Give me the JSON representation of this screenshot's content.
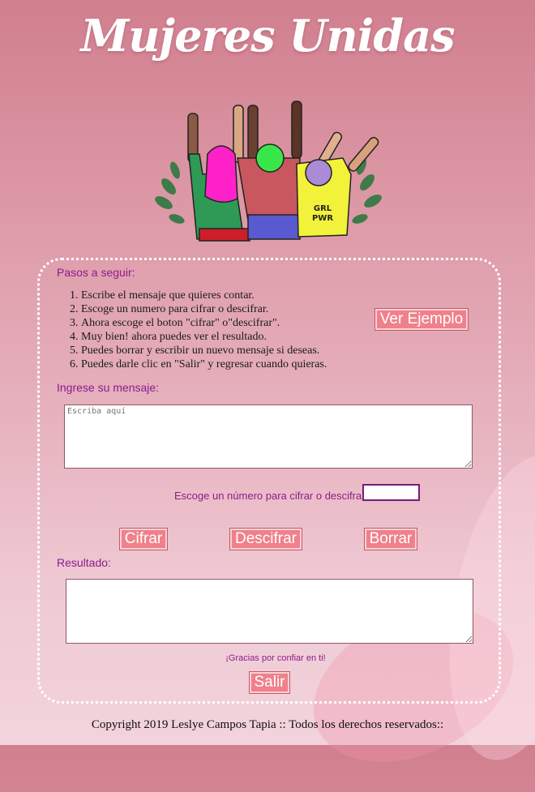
{
  "header": {
    "title": "Mujeres Unidas"
  },
  "instructions": {
    "heading": "Pasos a seguir:",
    "steps": [
      "Escribe el mensaje que quieres contar.",
      "Escoge un numero para cifrar o descifrar.",
      "Ahora escoge el boton \"cifrar\" o\"descifrar\".",
      "Muy bien! ahora puedes ver el resultado.",
      "Puedes borrar y escribir un nuevo mensaje si deseas.",
      "Puedes darle clic en \"Salir\" y regresar cuando quieras."
    ],
    "example_button": "Ver Ejemplo"
  },
  "message": {
    "label": "Ingrese su mensaje:",
    "placeholder": "Escriba aquí",
    "value": ""
  },
  "number": {
    "label": "Escoge un número para cifrar o descifrar",
    "value": ""
  },
  "actions": {
    "encrypt": "Cifrar",
    "decrypt": "Descifrar",
    "clear": "Borrar"
  },
  "result": {
    "label": "Resultado:",
    "value": ""
  },
  "thanks": "¡Gracias por confiar en ti!",
  "exit_button": "Salir",
  "footer": {
    "copyright": "Copyright 2019 Leslye Campos Tapia :: Todos los derechos reservados::"
  },
  "colors": {
    "accent": "#8d1b8f",
    "button": "#f0808a"
  }
}
